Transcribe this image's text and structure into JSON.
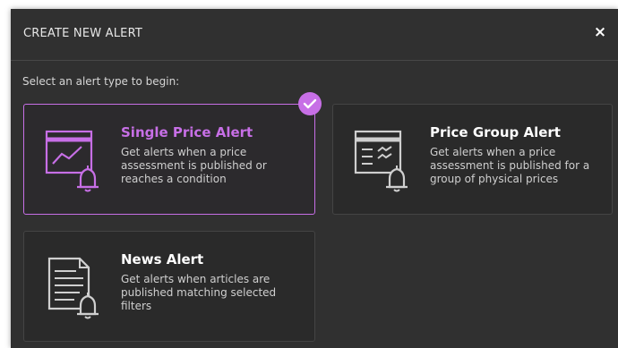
{
  "dialog": {
    "title": "CREATE NEW ALERT",
    "close_label": "×",
    "instruction": "Select an alert type to begin:"
  },
  "alert_types": [
    {
      "title": "Single Price Alert",
      "description": "Get alerts when a price assessment is published or reaches a condition",
      "icon": "price-chart-bell-icon",
      "selected": true
    },
    {
      "title": "Price Group Alert",
      "description": "Get alerts when a price assessment is published for a group of physical prices",
      "icon": "price-group-bell-icon",
      "selected": false
    },
    {
      "title": "News Alert",
      "description": "Get alerts when articles are published matching selected filters",
      "icon": "news-document-bell-icon",
      "selected": false
    }
  ],
  "colors": {
    "accent": "#c76fe6",
    "dialog_background": "#303030",
    "card_background": "#2a2a2a",
    "text_primary": "#ffffff",
    "text_secondary": "#cfcfcf"
  }
}
